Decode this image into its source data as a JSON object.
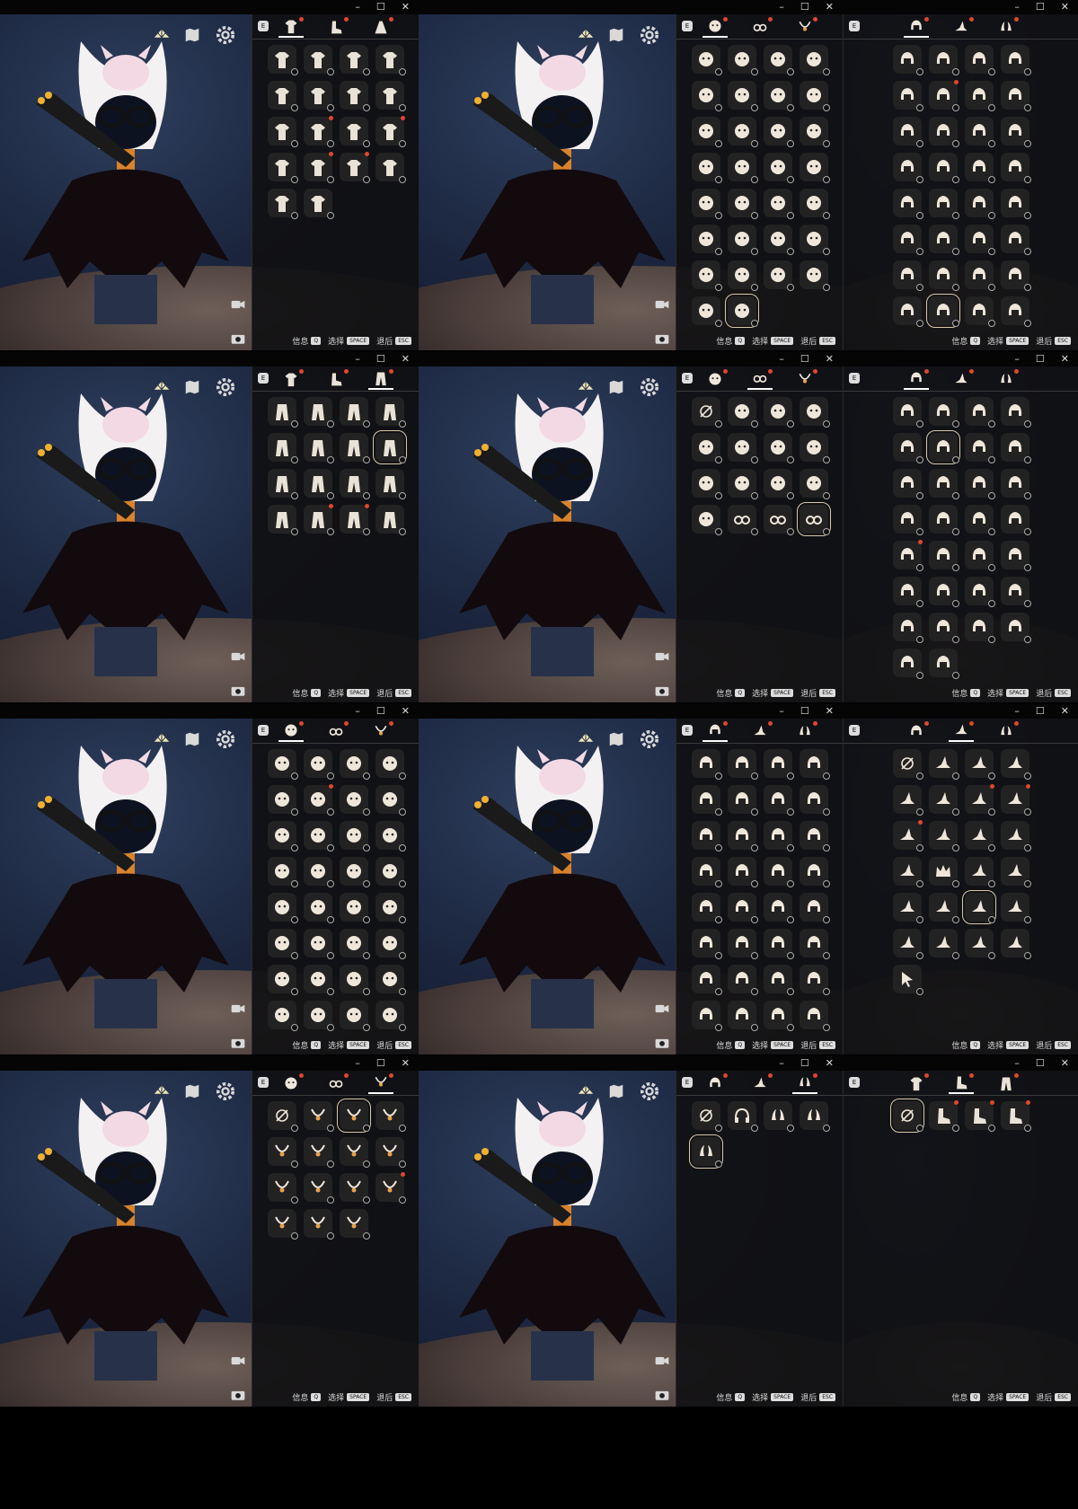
{
  "window_controls": {
    "minimize": "–",
    "maximize": "☐",
    "close": "✕"
  },
  "tab_key": "E",
  "hints": [
    {
      "label": "信息",
      "key": "Q"
    },
    {
      "label": "选择",
      "key": "SPACE"
    },
    {
      "label": "退后",
      "key": "ESC"
    }
  ],
  "colors": {
    "panel_bg": "#101012",
    "item_bg": "#222222",
    "accent_new": "#e0462e",
    "selected_outline": "#d9c9a8",
    "tab_active": "#ffffff"
  },
  "icons": {
    "top": [
      "fan-icon",
      "map-icon",
      "gear-icon"
    ],
    "side": [
      "video-camera-icon",
      "photo-camera-icon"
    ]
  },
  "cells": [
    {
      "id": "r1a",
      "tabs": [
        "outfit-icon",
        "shoes-icon",
        "cape-icon"
      ],
      "active_tab": 0,
      "items": [
        {
          "icon": "outfit-icon"
        },
        {
          "icon": "outfit-icon"
        },
        {
          "icon": "outfit-icon"
        },
        {
          "icon": "outfit-icon"
        },
        {
          "icon": "outfit-icon"
        },
        {
          "icon": "outfit-icon"
        },
        {
          "icon": "outfit-icon"
        },
        {
          "icon": "outfit-icon"
        },
        {
          "icon": "outfit-icon"
        },
        {
          "icon": "outfit-icon",
          "new": true
        },
        {
          "icon": "outfit-icon"
        },
        {
          "icon": "outfit-icon",
          "new": true
        },
        {
          "icon": "outfit-icon"
        },
        {
          "icon": "outfit-icon",
          "new": true
        },
        {
          "icon": "outfit-icon",
          "new": true
        },
        {
          "icon": "outfit-icon"
        },
        {
          "icon": "outfit-icon"
        },
        {
          "icon": "outfit-icon"
        }
      ]
    },
    {
      "id": "r1b",
      "tabs": [
        "mask-icon",
        "glasses-icon",
        "necklace-icon"
      ],
      "active_tab": 0,
      "items": [
        {
          "icon": "mask-icon"
        },
        {
          "icon": "mask-icon"
        },
        {
          "icon": "mask-icon"
        },
        {
          "icon": "mask-icon"
        },
        {
          "icon": "mask-icon"
        },
        {
          "icon": "mask-icon"
        },
        {
          "icon": "mask-icon"
        },
        {
          "icon": "mask-icon"
        },
        {
          "icon": "mask-icon"
        },
        {
          "icon": "mask-icon"
        },
        {
          "icon": "mask-icon"
        },
        {
          "icon": "mask-icon"
        },
        {
          "icon": "mask-icon"
        },
        {
          "icon": "mask-icon"
        },
        {
          "icon": "mask-icon"
        },
        {
          "icon": "mask-icon"
        },
        {
          "icon": "mask-icon"
        },
        {
          "icon": "mask-icon"
        },
        {
          "icon": "mask-icon"
        },
        {
          "icon": "mask-icon"
        },
        {
          "icon": "mask-icon"
        },
        {
          "icon": "mask-icon"
        },
        {
          "icon": "mask-icon"
        },
        {
          "icon": "mask-icon"
        },
        {
          "icon": "mask-icon"
        },
        {
          "icon": "mask-icon"
        },
        {
          "icon": "mask-icon"
        },
        {
          "icon": "mask-icon"
        },
        {
          "icon": "mask-icon"
        },
        {
          "icon": "mask-icon",
          "sel": true
        }
      ]
    },
    {
      "id": "r1c",
      "tabs": [
        "hair-icon",
        "hat-icon",
        "horn-icon"
      ],
      "active_tab": 0,
      "items": [
        {
          "icon": "hair-icon"
        },
        {
          "icon": "hair-icon"
        },
        {
          "icon": "hair-icon"
        },
        {
          "icon": "hair-icon"
        },
        {
          "icon": "hair-icon"
        },
        {
          "icon": "hair-icon",
          "new": true
        },
        {
          "icon": "hair-icon"
        },
        {
          "icon": "hair-icon"
        },
        {
          "icon": "hair-icon"
        },
        {
          "icon": "hair-icon"
        },
        {
          "icon": "hair-icon"
        },
        {
          "icon": "hair-icon"
        },
        {
          "icon": "hair-icon"
        },
        {
          "icon": "hair-icon"
        },
        {
          "icon": "hair-icon"
        },
        {
          "icon": "hair-icon"
        },
        {
          "icon": "hair-icon"
        },
        {
          "icon": "hair-icon"
        },
        {
          "icon": "hair-icon"
        },
        {
          "icon": "hair-icon"
        },
        {
          "icon": "hair-icon"
        },
        {
          "icon": "hair-icon"
        },
        {
          "icon": "hair-icon"
        },
        {
          "icon": "hair-icon"
        },
        {
          "icon": "hair-icon"
        },
        {
          "icon": "hair-icon"
        },
        {
          "icon": "hair-icon"
        },
        {
          "icon": "hair-icon"
        },
        {
          "icon": "hair-icon"
        },
        {
          "icon": "hair-icon",
          "sel": true
        },
        {
          "icon": "hair-icon"
        },
        {
          "icon": "hair-icon"
        }
      ]
    },
    {
      "id": "r2a",
      "tabs": [
        "outfit-icon",
        "shoes-icon",
        "pants-icon"
      ],
      "active_tab": 2,
      "items": [
        {
          "icon": "pants-icon"
        },
        {
          "icon": "pants-icon"
        },
        {
          "icon": "pants-icon"
        },
        {
          "icon": "pants-icon"
        },
        {
          "icon": "pants-icon"
        },
        {
          "icon": "pants-icon"
        },
        {
          "icon": "pants-icon"
        },
        {
          "icon": "pants-icon",
          "sel": true
        },
        {
          "icon": "pants-icon"
        },
        {
          "icon": "pants-icon"
        },
        {
          "icon": "pants-icon"
        },
        {
          "icon": "pants-icon"
        },
        {
          "icon": "pants-icon"
        },
        {
          "icon": "pants-icon",
          "new": true
        },
        {
          "icon": "pants-icon",
          "new": true
        },
        {
          "icon": "pants-icon"
        }
      ]
    },
    {
      "id": "r2b",
      "tabs": [
        "mask-icon",
        "glasses-icon",
        "necklace-icon"
      ],
      "active_tab": 1,
      "items": [
        {
          "icon": "none-icon"
        },
        {
          "icon": "mask-icon"
        },
        {
          "icon": "mask-icon"
        },
        {
          "icon": "mask-icon"
        },
        {
          "icon": "mask-icon"
        },
        {
          "icon": "mask-icon"
        },
        {
          "icon": "mask-icon"
        },
        {
          "icon": "mask-icon"
        },
        {
          "icon": "mask-icon"
        },
        {
          "icon": "mask-icon"
        },
        {
          "icon": "mask-icon"
        },
        {
          "icon": "mask-icon"
        },
        {
          "icon": "mask-icon"
        },
        {
          "icon": "glasses-icon"
        },
        {
          "icon": "glasses-icon"
        },
        {
          "icon": "glasses-icon",
          "sel": true
        }
      ]
    },
    {
      "id": "r2c",
      "tabs": [
        "hair-icon",
        "hat-icon",
        "horn-icon"
      ],
      "active_tab": 0,
      "items": [
        {
          "icon": "hair-icon"
        },
        {
          "icon": "hair-icon"
        },
        {
          "icon": "hair-icon"
        },
        {
          "icon": "hair-icon"
        },
        {
          "icon": "hair-icon"
        },
        {
          "icon": "hair-icon",
          "sel": true
        },
        {
          "icon": "hair-icon"
        },
        {
          "icon": "hair-icon"
        },
        {
          "icon": "hair-icon"
        },
        {
          "icon": "hair-icon"
        },
        {
          "icon": "hair-icon"
        },
        {
          "icon": "hair-icon"
        },
        {
          "icon": "hair-icon"
        },
        {
          "icon": "hair-icon"
        },
        {
          "icon": "hair-icon"
        },
        {
          "icon": "hair-icon"
        },
        {
          "icon": "hair-icon",
          "new": true
        },
        {
          "icon": "hair-icon"
        },
        {
          "icon": "hair-icon"
        },
        {
          "icon": "hair-icon"
        },
        {
          "icon": "hair-icon"
        },
        {
          "icon": "hair-icon"
        },
        {
          "icon": "hair-icon"
        },
        {
          "icon": "hair-icon"
        },
        {
          "icon": "hair-icon"
        },
        {
          "icon": "hair-icon"
        },
        {
          "icon": "hair-icon"
        },
        {
          "icon": "hair-icon"
        },
        {
          "icon": "hair-icon"
        },
        {
          "icon": "hair-icon"
        }
      ]
    },
    {
      "id": "r3a",
      "tabs": [
        "mask-icon",
        "glasses-icon",
        "necklace-icon"
      ],
      "active_tab": 0,
      "items": [
        {
          "icon": "mask-icon"
        },
        {
          "icon": "mask-icon"
        },
        {
          "icon": "mask-icon"
        },
        {
          "icon": "mask-icon"
        },
        {
          "icon": "mask-icon"
        },
        {
          "icon": "mask-icon",
          "new": true
        },
        {
          "icon": "mask-icon"
        },
        {
          "icon": "mask-icon"
        },
        {
          "icon": "mask-icon"
        },
        {
          "icon": "mask-icon"
        },
        {
          "icon": "mask-icon"
        },
        {
          "icon": "mask-icon"
        },
        {
          "icon": "mask-icon"
        },
        {
          "icon": "mask-icon"
        },
        {
          "icon": "mask-icon"
        },
        {
          "icon": "mask-icon"
        },
        {
          "icon": "mask-icon"
        },
        {
          "icon": "mask-icon"
        },
        {
          "icon": "mask-icon"
        },
        {
          "icon": "mask-icon"
        },
        {
          "icon": "mask-icon"
        },
        {
          "icon": "mask-icon"
        },
        {
          "icon": "mask-icon"
        },
        {
          "icon": "mask-icon"
        },
        {
          "icon": "mask-icon"
        },
        {
          "icon": "mask-icon"
        },
        {
          "icon": "mask-icon"
        },
        {
          "icon": "mask-icon"
        },
        {
          "icon": "mask-icon"
        },
        {
          "icon": "mask-icon"
        },
        {
          "icon": "mask-icon"
        },
        {
          "icon": "mask-icon"
        }
      ]
    },
    {
      "id": "r3b",
      "tabs": [
        "hair-icon",
        "hat-icon",
        "horn-icon"
      ],
      "active_tab": 0,
      "items": [
        {
          "icon": "hair-icon"
        },
        {
          "icon": "hair-icon"
        },
        {
          "icon": "hair-icon"
        },
        {
          "icon": "hair-icon"
        },
        {
          "icon": "hair-icon"
        },
        {
          "icon": "hair-icon"
        },
        {
          "icon": "hair-icon"
        },
        {
          "icon": "hair-icon"
        },
        {
          "icon": "hair-icon"
        },
        {
          "icon": "hair-icon"
        },
        {
          "icon": "hair-icon"
        },
        {
          "icon": "hair-icon"
        },
        {
          "icon": "hair-icon"
        },
        {
          "icon": "hair-icon"
        },
        {
          "icon": "hair-icon"
        },
        {
          "icon": "hair-icon"
        },
        {
          "icon": "hair-icon"
        },
        {
          "icon": "hair-icon"
        },
        {
          "icon": "hair-icon"
        },
        {
          "icon": "hair-icon"
        },
        {
          "icon": "hair-icon"
        },
        {
          "icon": "hair-icon"
        },
        {
          "icon": "hair-icon"
        },
        {
          "icon": "hair-icon"
        },
        {
          "icon": "hair-icon"
        },
        {
          "icon": "hair-icon"
        },
        {
          "icon": "hair-icon"
        },
        {
          "icon": "hair-icon"
        },
        {
          "icon": "hair-icon"
        },
        {
          "icon": "hair-icon"
        },
        {
          "icon": "hair-icon"
        },
        {
          "icon": "hair-icon"
        }
      ]
    },
    {
      "id": "r3c",
      "tabs": [
        "hair-icon",
        "hat-icon",
        "horn-icon"
      ],
      "active_tab": 1,
      "items": [
        {
          "icon": "none-icon"
        },
        {
          "icon": "hat-icon"
        },
        {
          "icon": "hat-icon"
        },
        {
          "icon": "hat-icon"
        },
        {
          "icon": "hat-icon"
        },
        {
          "icon": "hat-icon"
        },
        {
          "icon": "hat-icon",
          "new": true
        },
        {
          "icon": "hat-icon",
          "new": true
        },
        {
          "icon": "hat-icon",
          "new": true
        },
        {
          "icon": "hat-icon"
        },
        {
          "icon": "hat-icon"
        },
        {
          "icon": "hat-icon"
        },
        {
          "icon": "hat-icon"
        },
        {
          "icon": "crown-icon"
        },
        {
          "icon": "hat-icon"
        },
        {
          "icon": "hat-icon"
        },
        {
          "icon": "hat-icon"
        },
        {
          "icon": "hat-icon"
        },
        {
          "icon": "hat-icon",
          "sel": true
        },
        {
          "icon": "hat-icon"
        },
        {
          "icon": "hat-icon"
        },
        {
          "icon": "hat-icon"
        },
        {
          "icon": "hat-icon"
        },
        {
          "icon": "hat-icon"
        },
        {
          "icon": "cursor-icon"
        }
      ]
    },
    {
      "id": "r4a",
      "tabs": [
        "mask-icon",
        "glasses-icon",
        "necklace-icon"
      ],
      "active_tab": 2,
      "items": [
        {
          "icon": "none-icon"
        },
        {
          "icon": "necklace-icon"
        },
        {
          "icon": "necklace-icon",
          "sel": true
        },
        {
          "icon": "necklace-icon"
        },
        {
          "icon": "necklace-icon"
        },
        {
          "icon": "necklace-icon"
        },
        {
          "icon": "necklace-icon"
        },
        {
          "icon": "necklace-icon"
        },
        {
          "icon": "necklace-icon"
        },
        {
          "icon": "necklace-icon"
        },
        {
          "icon": "necklace-icon"
        },
        {
          "icon": "necklace-icon",
          "new": true
        },
        {
          "icon": "necklace-icon"
        },
        {
          "icon": "necklace-icon"
        },
        {
          "icon": "necklace-icon"
        }
      ]
    },
    {
      "id": "r4b",
      "tabs": [
        "hair-icon",
        "hat-icon",
        "horn-icon"
      ],
      "active_tab": 2,
      "items": [
        {
          "icon": "none-icon"
        },
        {
          "icon": "headphones-icon"
        },
        {
          "icon": "horn-icon"
        },
        {
          "icon": "horn-icon"
        },
        {
          "icon": "horn-icon",
          "sel": true
        }
      ]
    },
    {
      "id": "r4c",
      "tabs": [
        "outfit-icon",
        "shoes-icon",
        "pants-icon"
      ],
      "active_tab": 1,
      "items": [
        {
          "icon": "none-icon",
          "sel": true
        },
        {
          "icon": "shoes-icon",
          "new": true
        },
        {
          "icon": "shoes-icon",
          "new": true
        },
        {
          "icon": "shoes-icon",
          "new": true
        }
      ]
    }
  ]
}
